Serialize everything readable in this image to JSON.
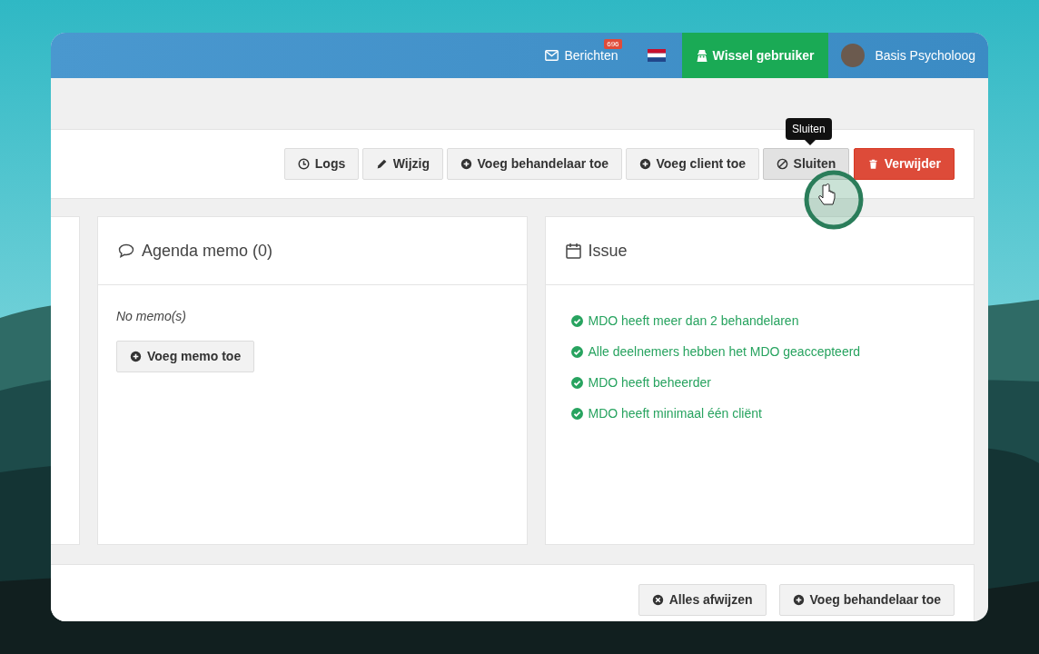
{
  "navbar": {
    "messages": {
      "label": "Berichten",
      "count": "696"
    },
    "switch_user": "Wissel gebruiker",
    "user": "Basis Psycholoog"
  },
  "toolbar": {
    "buttons": [
      {
        "label": "Logs",
        "kind": "clock",
        "hovered": false
      },
      {
        "label": "Wijzig",
        "kind": "pencil",
        "hovered": false
      },
      {
        "label": "Voeg behandelaar toe",
        "kind": "plus",
        "hovered": false
      },
      {
        "label": "Voeg client toe",
        "kind": "plus",
        "hovered": false
      },
      {
        "label": "Sluiten",
        "kind": "ban",
        "hovered": true
      },
      {
        "label": "Verwijder",
        "kind": "trash",
        "hovered": false
      }
    ],
    "tooltip": "Sluiten"
  },
  "memo_panel": {
    "title": "Agenda memo (0)",
    "empty_text": "No memo(s)",
    "button": "Voeg memo toe"
  },
  "issue_panel": {
    "title": "Issue",
    "items": [
      {
        "text": "MDO heeft meer dan 2 behandelaren",
        "checked": true
      },
      {
        "text": "Alle deelnemers hebben het MDO geaccepteerd",
        "checked": true
      },
      {
        "text": "MDO heeft beheerder",
        "checked": true
      },
      {
        "text": "MDO heeft minimaal één cliënt",
        "checked": true
      }
    ]
  },
  "bottom_toolbar": {
    "buttons": [
      {
        "label": "Alles afwijzen",
        "kind": "dismiss"
      },
      {
        "label": "Voeg behandelaar toe",
        "kind": "plus"
      }
    ]
  }
}
